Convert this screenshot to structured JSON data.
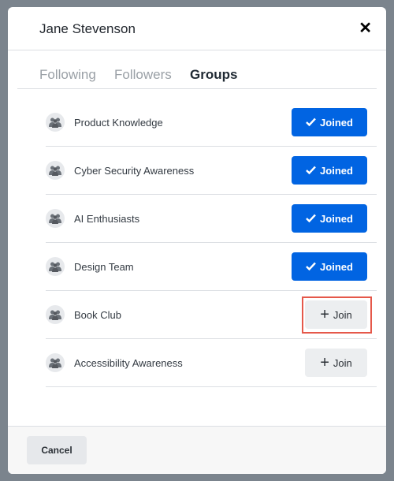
{
  "modal": {
    "title": "Jane Stevenson",
    "close_icon": "close-icon"
  },
  "tabs": [
    {
      "label": "Following"
    },
    {
      "label": "Followers"
    },
    {
      "label": "Groups",
      "active": true
    }
  ],
  "groups": [
    {
      "name": "Product Knowledge",
      "status": "Joined"
    },
    {
      "name": "Cyber Security Awareness",
      "status": "Joined"
    },
    {
      "name": "AI Enthusiasts",
      "status": "Joined"
    },
    {
      "name": "Design Team",
      "status": "Joined"
    },
    {
      "name": "Book Club",
      "status": "Join",
      "highlighted": true
    },
    {
      "name": "Accessibility Awareness",
      "status": "Join"
    }
  ],
  "footer": {
    "cancel_label": "Cancel"
  },
  "colors": {
    "accent": "#0164e2",
    "highlight": "#e5584a"
  }
}
